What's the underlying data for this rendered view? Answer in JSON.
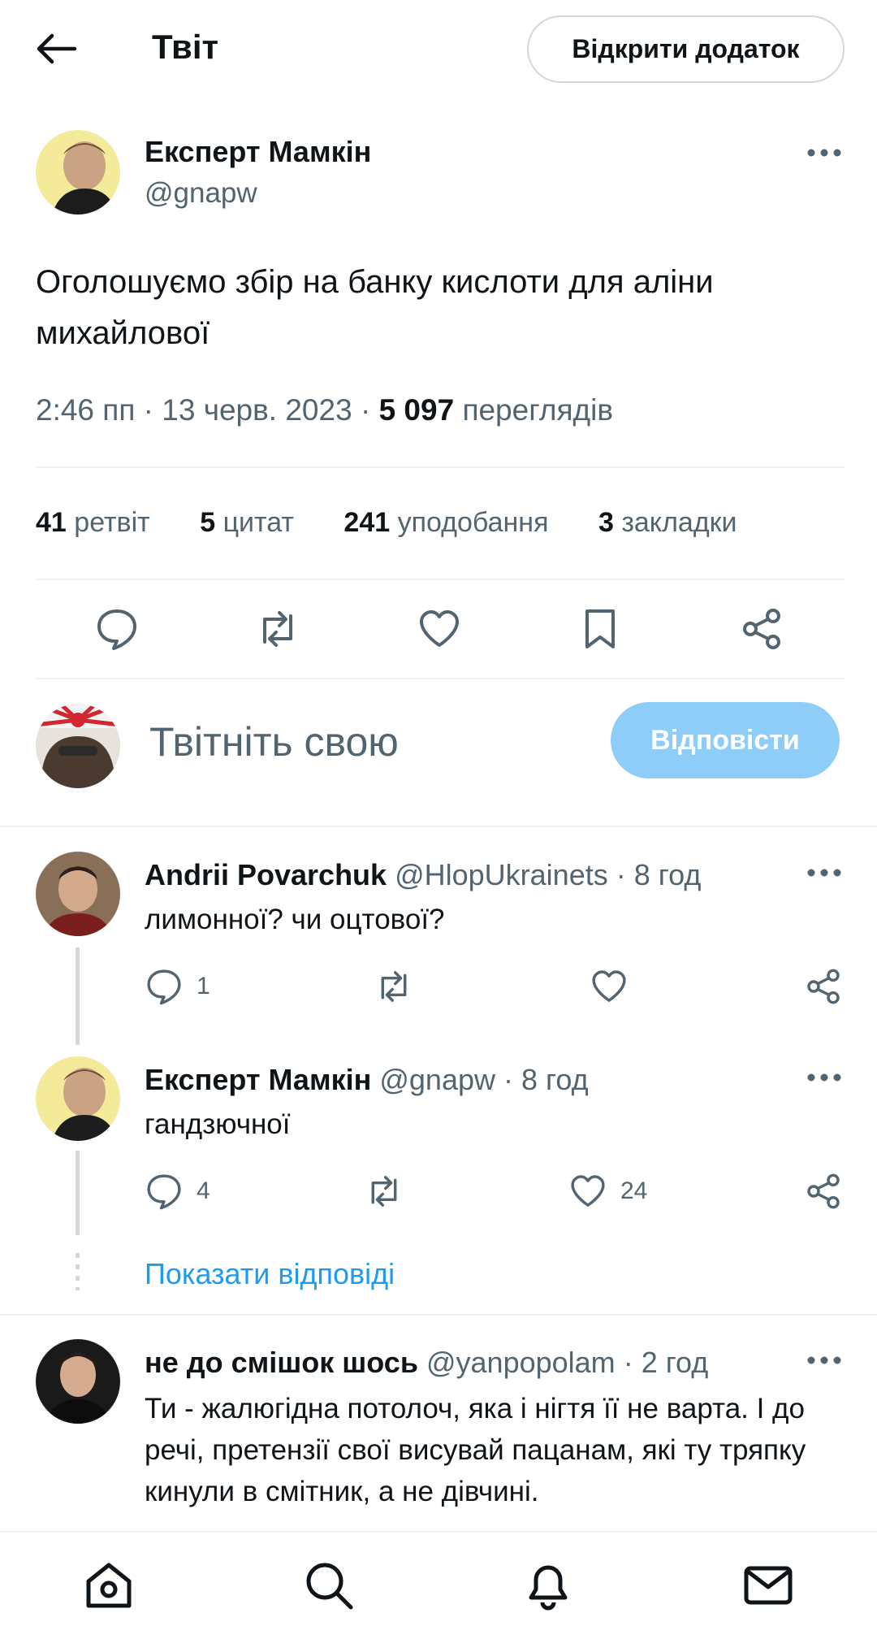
{
  "header": {
    "title": "Твіт",
    "open_app_label": "Відкрити додаток"
  },
  "tweet": {
    "author_name": "Експерт Мамкін",
    "author_handle": "@gnapw",
    "text": "Оголошуємо збір на банку кислоти для аліни михайлової",
    "time": "2:46 пп",
    "date": "13 черв. 2023",
    "views_count": "5 097",
    "views_label": "переглядів",
    "stats": [
      {
        "count": "41",
        "label": "ретвіт"
      },
      {
        "count": "5",
        "label": "цитат"
      },
      {
        "count": "241",
        "label": "уподобання"
      },
      {
        "count": "3",
        "label": "закладки"
      }
    ]
  },
  "compose": {
    "placeholder": "Твітніть свою",
    "reply_label": "Відповісти"
  },
  "replies": [
    {
      "name": "Andrii Povarchuk",
      "handle": "@HlopUkrainets",
      "time": "8 год",
      "text": "лимонної? чи оцтової?",
      "reply_count": "1",
      "retweet_count": "",
      "like_count": ""
    },
    {
      "name": "Експерт Мамкін",
      "handle": "@gnapw",
      "time": "8 год",
      "text": "гандзючної",
      "reply_count": "4",
      "retweet_count": "",
      "like_count": "24"
    },
    {
      "name": "не до смішок шось",
      "handle": "@yanpopolam",
      "time": "2 год",
      "text": "Ти - жалюгідна потолоч, яка і нігтя її не варта. І до речі, претензії свої висувай пацанам, які ту тряпку кинули в смітник, а не дівчині."
    }
  ],
  "show_replies_label": "Показати відповіді",
  "icons": {
    "back": "arrow-left-icon",
    "more": "more-horizontal-icon",
    "reply": "reply-icon",
    "retweet": "retweet-icon",
    "like": "heart-icon",
    "bookmark": "bookmark-icon",
    "share": "share-icon",
    "home": "home-icon",
    "search": "search-icon",
    "notifications": "bell-icon",
    "messages": "mail-icon"
  },
  "colors": {
    "accent": "#1d9bf0",
    "reply_button_disabled": "#8ecdf8",
    "muted_text": "#536471",
    "divider": "#eff3f4"
  }
}
